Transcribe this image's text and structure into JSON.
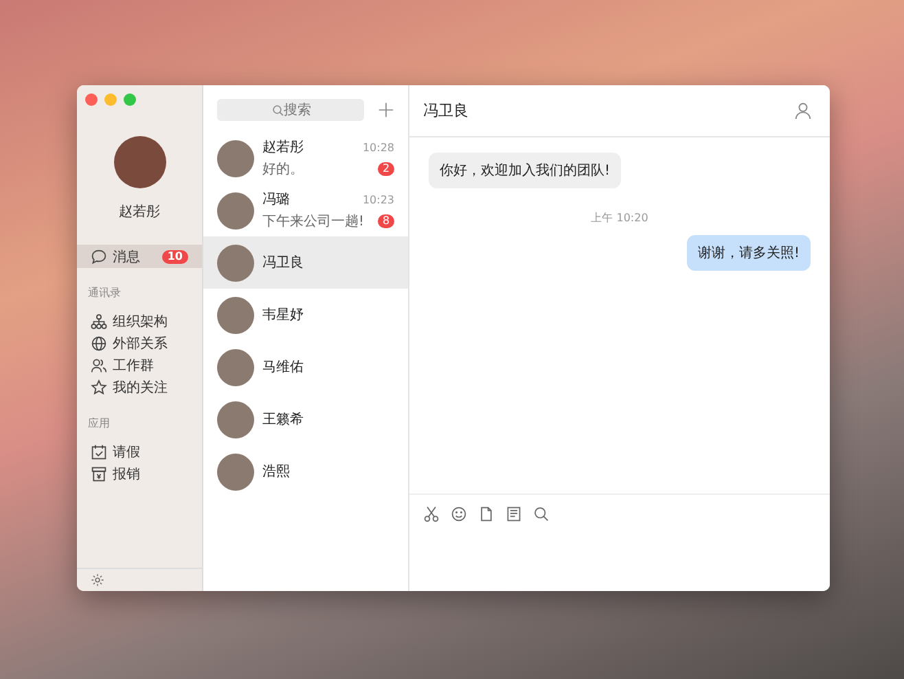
{
  "user": {
    "name": "赵若彤"
  },
  "nav": {
    "messages": {
      "label": "消息",
      "badge": "10",
      "selected": true
    },
    "sections": [
      {
        "title": "通讯录",
        "items": [
          {
            "label": "组织架构",
            "kind": "org"
          },
          {
            "label": "外部关系",
            "kind": "globe"
          },
          {
            "label": "工作群",
            "kind": "group"
          },
          {
            "label": "我的关注",
            "kind": "star"
          }
        ]
      },
      {
        "title": "应用",
        "items": [
          {
            "label": "请假",
            "kind": "calendar"
          },
          {
            "label": "报销",
            "kind": "receipt"
          }
        ]
      }
    ]
  },
  "search": {
    "placeholder": "搜索"
  },
  "conversations": [
    {
      "name": "赵若彤",
      "preview": "好的。",
      "time": "10:28",
      "badge": "2",
      "selected": false
    },
    {
      "name": "冯璐",
      "preview": "下午来公司一趟!",
      "time": "10:23",
      "badge": "8",
      "selected": false
    },
    {
      "name": "冯卫良",
      "selected": true
    },
    {
      "name": "韦星妤",
      "selected": false
    },
    {
      "name": "马维佑",
      "selected": false
    },
    {
      "name": "王籁希",
      "selected": false
    },
    {
      "name": "浩熙",
      "selected": false
    }
  ],
  "chat": {
    "title": "冯卫良",
    "messages": [
      {
        "kind": "received",
        "text": "你好，欢迎加入我们的团队!"
      },
      {
        "kind": "time",
        "text": "上午 10:20"
      },
      {
        "kind": "sent",
        "text": "谢谢，请多关照!"
      }
    ]
  }
}
